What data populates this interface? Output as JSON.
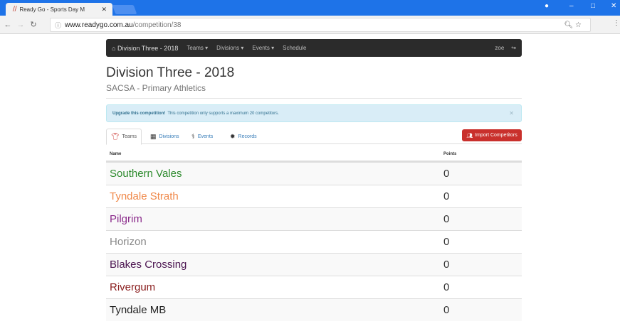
{
  "browser": {
    "tab_title": "Ready Go - Sports Day M",
    "tab_icon": "ready-go-favicon",
    "url_host": "www.readygo.com.au",
    "url_path": "/competition/38",
    "accent": "#1e73e8"
  },
  "navbar": {
    "brand": "Division Three - 2018",
    "items": [
      "Teams ▾",
      "Divisions ▾",
      "Events ▾",
      "Schedule"
    ],
    "user": "zoe"
  },
  "header": {
    "title": "Division Three - 2018",
    "subtitle": "SACSA - Primary Athletics"
  },
  "alert": {
    "strong": "Upgrade this competition!",
    "text": "This competition only supports a maximum 20 competitors."
  },
  "tabs": [
    {
      "label": "Teams",
      "icon": "tshirt-icon"
    },
    {
      "label": "Divisions",
      "icon": "grid-icon"
    },
    {
      "label": "Events",
      "icon": "runner-icon"
    },
    {
      "label": "Records",
      "icon": "medal-icon"
    }
  ],
  "import_button": "Import Competitors",
  "table": {
    "headers": [
      "Name",
      "Points"
    ],
    "rows": [
      {
        "name": "Southern Vales",
        "points": "0",
        "color": "#2e8b2e"
      },
      {
        "name": "Tyndale Strath",
        "points": "0",
        "color": "#f0894a"
      },
      {
        "name": "Pilgrim",
        "points": "0",
        "color": "#8a2a8a"
      },
      {
        "name": "Horizon",
        "points": "0",
        "color": "#8a8a8a"
      },
      {
        "name": "Blakes Crossing",
        "points": "0",
        "color": "#4b1450"
      },
      {
        "name": "Rivergum",
        "points": "0",
        "color": "#8b2020"
      },
      {
        "name": "Tyndale MB",
        "points": "0",
        "color": "#222222"
      }
    ]
  }
}
